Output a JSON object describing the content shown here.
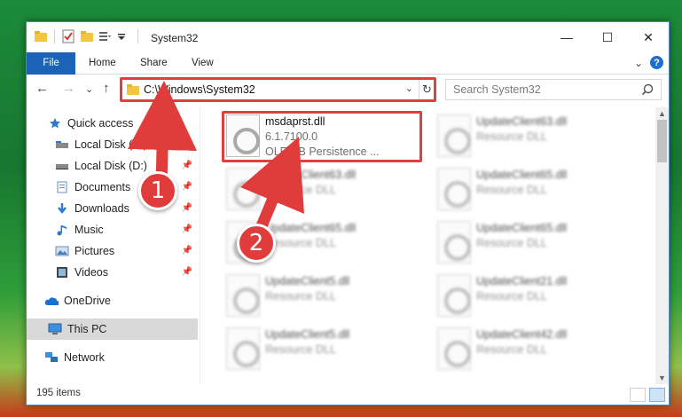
{
  "titlebar": {
    "title": "System32",
    "minimize": "—",
    "maximize": "☐",
    "close": "✕"
  },
  "ribbon": {
    "tabs": [
      "File",
      "Home",
      "Share",
      "View"
    ],
    "expand": "⌄",
    "help": "?"
  },
  "nav": {
    "address": "C:\\Windows\\System32",
    "search_placeholder": "Search System32",
    "back": "←",
    "forward": "→",
    "recent": "⌄",
    "up": "↑",
    "refresh": "↻"
  },
  "sidebar": {
    "items": [
      {
        "label": "Quick access",
        "icon": "star-icon",
        "pinned": false
      },
      {
        "label": "Local Disk (C:)",
        "icon": "drive-icon",
        "pinned": true
      },
      {
        "label": "Local Disk (D:)",
        "icon": "drive-icon",
        "pinned": true
      },
      {
        "label": "Documents",
        "icon": "document-icon",
        "pinned": true
      },
      {
        "label": "Downloads",
        "icon": "download-icon",
        "pinned": true
      },
      {
        "label": "Music",
        "icon": "music-icon",
        "pinned": true
      },
      {
        "label": "Pictures",
        "icon": "pictures-icon",
        "pinned": true
      },
      {
        "label": "Videos",
        "icon": "video-icon",
        "pinned": true
      },
      {
        "label": "OneDrive",
        "icon": "cloud-icon",
        "pinned": false
      },
      {
        "label": "This PC",
        "icon": "computer-icon",
        "pinned": false
      },
      {
        "label": "Network",
        "icon": "network-icon",
        "pinned": false
      }
    ]
  },
  "files": [
    {
      "name": "msdaprst.dll",
      "line2": "6.1.7100.0",
      "line3": "OLE DB Persistence ...",
      "blurred": false
    },
    {
      "name": "UpdateClient63.dll",
      "line2": "Resource DLL",
      "blurred": true
    },
    {
      "name": "UpdateClient63.dll",
      "line2": "Resource DLL",
      "blurred": true
    },
    {
      "name": "UpdateClient65.dll",
      "line2": "Resource DLL",
      "blurred": true
    },
    {
      "name": "UpdateClient65.dll",
      "line2": "Resource DLL",
      "blurred": true
    },
    {
      "name": "UpdateClient65.dll",
      "line2": "Resource DLL",
      "blurred": true
    },
    {
      "name": "UpdateClient5.dll",
      "line2": "Resource DLL",
      "blurred": true
    },
    {
      "name": "UpdateClient21.dll",
      "line2": "Resource DLL",
      "blurred": true
    },
    {
      "name": "UpdateClient5.dll",
      "line2": "Resource DLL",
      "blurred": true
    },
    {
      "name": "UpdateClient42.dll",
      "line2": "Resource DLL",
      "blurred": true
    }
  ],
  "status": {
    "count": "195 items"
  },
  "annotations": {
    "badge1": "1",
    "badge2": "2",
    "color": "#e03c3c"
  },
  "colors": {
    "accent": "#1c63b7",
    "highlight": "#e23e3e"
  }
}
